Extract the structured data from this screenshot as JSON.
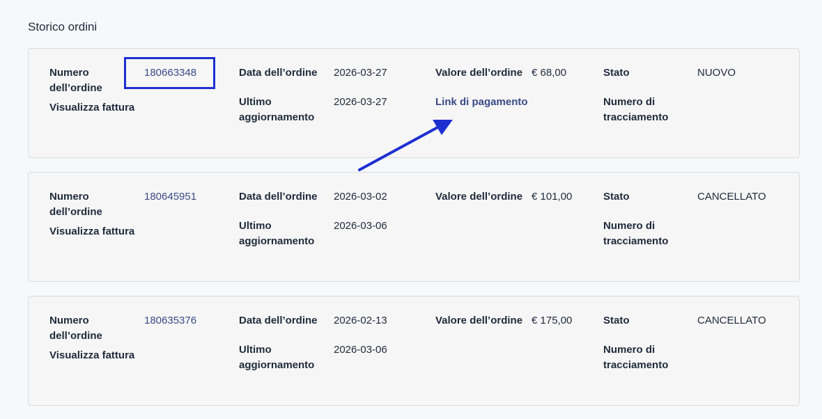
{
  "page": {
    "title": "Storico ordini"
  },
  "labels": {
    "order_number": "Numero dell’ordine",
    "view_invoice": "Visualizza fattura",
    "order_date": "Data dell’ordine",
    "last_update": "Ultimo aggiornamento",
    "order_value": "Valore dell’ordine",
    "status": "Stato",
    "tracking_number": "Numero di tracciamento",
    "payment_link": "Link di pagamento"
  },
  "orders": [
    {
      "number": "180663348",
      "date": "2026-03-27",
      "updated": "2026-03-27",
      "value": "€ 68,00",
      "status": "NUOVO"
    },
    {
      "number": "180645951",
      "date": "2026-03-02",
      "updated": "2026-03-06",
      "value": "€ 101,00",
      "status": "CANCELLATO"
    },
    {
      "number": "180635376",
      "date": "2026-02-13",
      "updated": "2026-03-06",
      "value": "€ 175,00",
      "status": "CANCELLATO"
    }
  ],
  "colors": {
    "link": "#3a4a86",
    "annotation": "#1d2fd0",
    "card_bg": "#f6f6f6",
    "page_bg": "#f5f9fc"
  }
}
